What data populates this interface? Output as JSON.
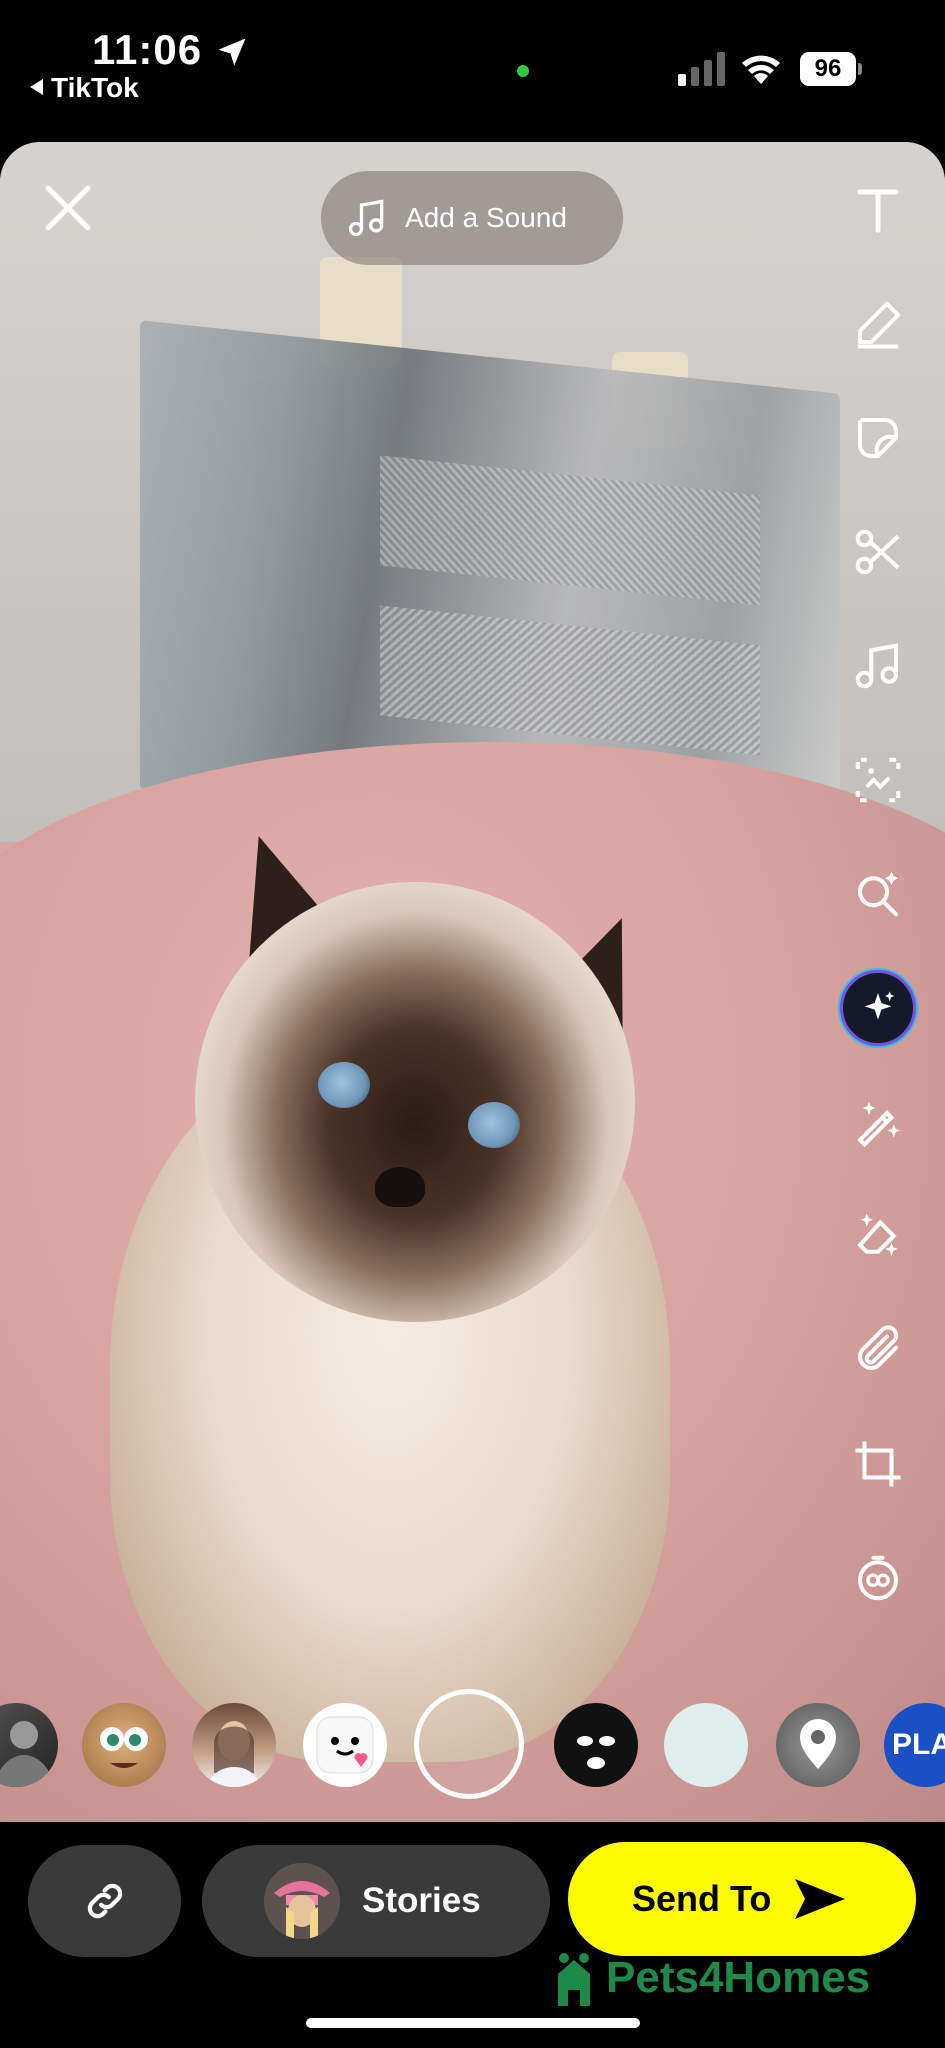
{
  "status_bar": {
    "time": "11:06",
    "back_app": "TikTok",
    "battery": "96",
    "icons": [
      "location-arrow-icon",
      "signal-icon",
      "wifi-icon",
      "battery-icon"
    ]
  },
  "editor": {
    "add_sound_label": "Add a Sound",
    "close_icon": "close-icon",
    "tools": [
      "text-icon",
      "pencil-icon",
      "sticker-icon",
      "scissors-icon",
      "music-icon",
      "scan-icon",
      "search-sparkle-icon",
      "ai-sparkle-icon",
      "magic-wand-icon",
      "eraser-icon",
      "paperclip-icon",
      "crop-icon",
      "timer-icon"
    ]
  },
  "lenses": {
    "items": [
      "bw-portrait",
      "cartoon-face",
      "portrait-girl",
      "marshmallow",
      "selected",
      "ski-mask",
      "plain-circle",
      "location-pin",
      "scratch-badge"
    ],
    "badge_text": "PLA"
  },
  "bottom_bar": {
    "stories_label": "Stories",
    "send_label": "Send To"
  },
  "watermark": "Pets4Homes",
  "colors": {
    "send_button": "#fffc00",
    "pill_bg": "#3a3a3a",
    "watermark": "#1d8a4a"
  }
}
